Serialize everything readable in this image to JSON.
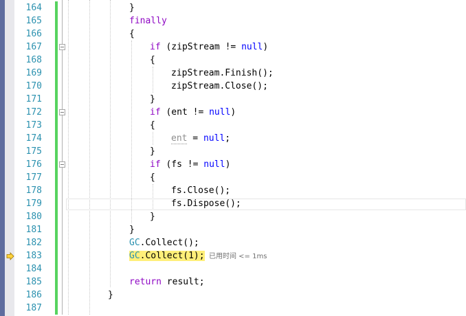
{
  "editor": {
    "line_numbers": [
      "164",
      "165",
      "166",
      "167",
      "168",
      "169",
      "170",
      "171",
      "172",
      "173",
      "174",
      "175",
      "176",
      "177",
      "178",
      "179",
      "180",
      "181",
      "182",
      "183",
      "184",
      "185",
      "186",
      "187"
    ],
    "current_statement_line": "183",
    "perf_tip": "已用时间 <= 1ms",
    "colors": {
      "keyword": "#0000ff",
      "control_keyword": "#8f08c4",
      "type": "#2b91af",
      "line_number": "#2b91af",
      "change_bar": "#57d35f",
      "statement_highlight": "#ffef79",
      "left_bar": "#5f6d9f"
    },
    "icons": {
      "execution_pointer": "yellow-arrow-icon",
      "collapse": "minus-box-icon"
    }
  },
  "code": {
    "l164": {
      "brace": "}"
    },
    "l165": {
      "kw": "finally"
    },
    "l166": {
      "brace": "{"
    },
    "l167": {
      "kw": "if",
      "rest": " (zipStream != ",
      "null": "null",
      "close": ")"
    },
    "l168": {
      "brace": "{"
    },
    "l169": {
      "obj": "zipStream",
      "dot": ".",
      "method": "Finish",
      "tail": "();"
    },
    "l170": {
      "obj": "zipStream",
      "dot": ".",
      "method": "Close",
      "tail": "();"
    },
    "l171": {
      "brace": "}"
    },
    "l172": {
      "kw": "if",
      "rest": " (ent != ",
      "null": "null",
      "close": ")"
    },
    "l173": {
      "brace": "{"
    },
    "l174": {
      "obj": "ent",
      "eq": " = ",
      "null": "null",
      "semi": ";"
    },
    "l175": {
      "brace": "}"
    },
    "l176": {
      "kw": "if",
      "rest": " (fs != ",
      "null": "null",
      "close": ")"
    },
    "l177": {
      "brace": "{"
    },
    "l178": {
      "obj": "fs",
      "dot": ".",
      "method": "Close",
      "tail": "();"
    },
    "l179": {
      "obj": "fs",
      "dot": ".",
      "method": "Dispose",
      "tail": "();"
    },
    "l180": {
      "brace": "}"
    },
    "l181": {
      "brace": "}"
    },
    "l182": {
      "type": "GC",
      "dot": ".",
      "method": "Collect",
      "tail": "();"
    },
    "l183": {
      "type": "GC",
      "dot": ".",
      "method": "Collect",
      "tail": "(1);"
    },
    "l185": {
      "kw": "return",
      "rest": " result;"
    },
    "l186": {
      "brace": "}"
    }
  }
}
